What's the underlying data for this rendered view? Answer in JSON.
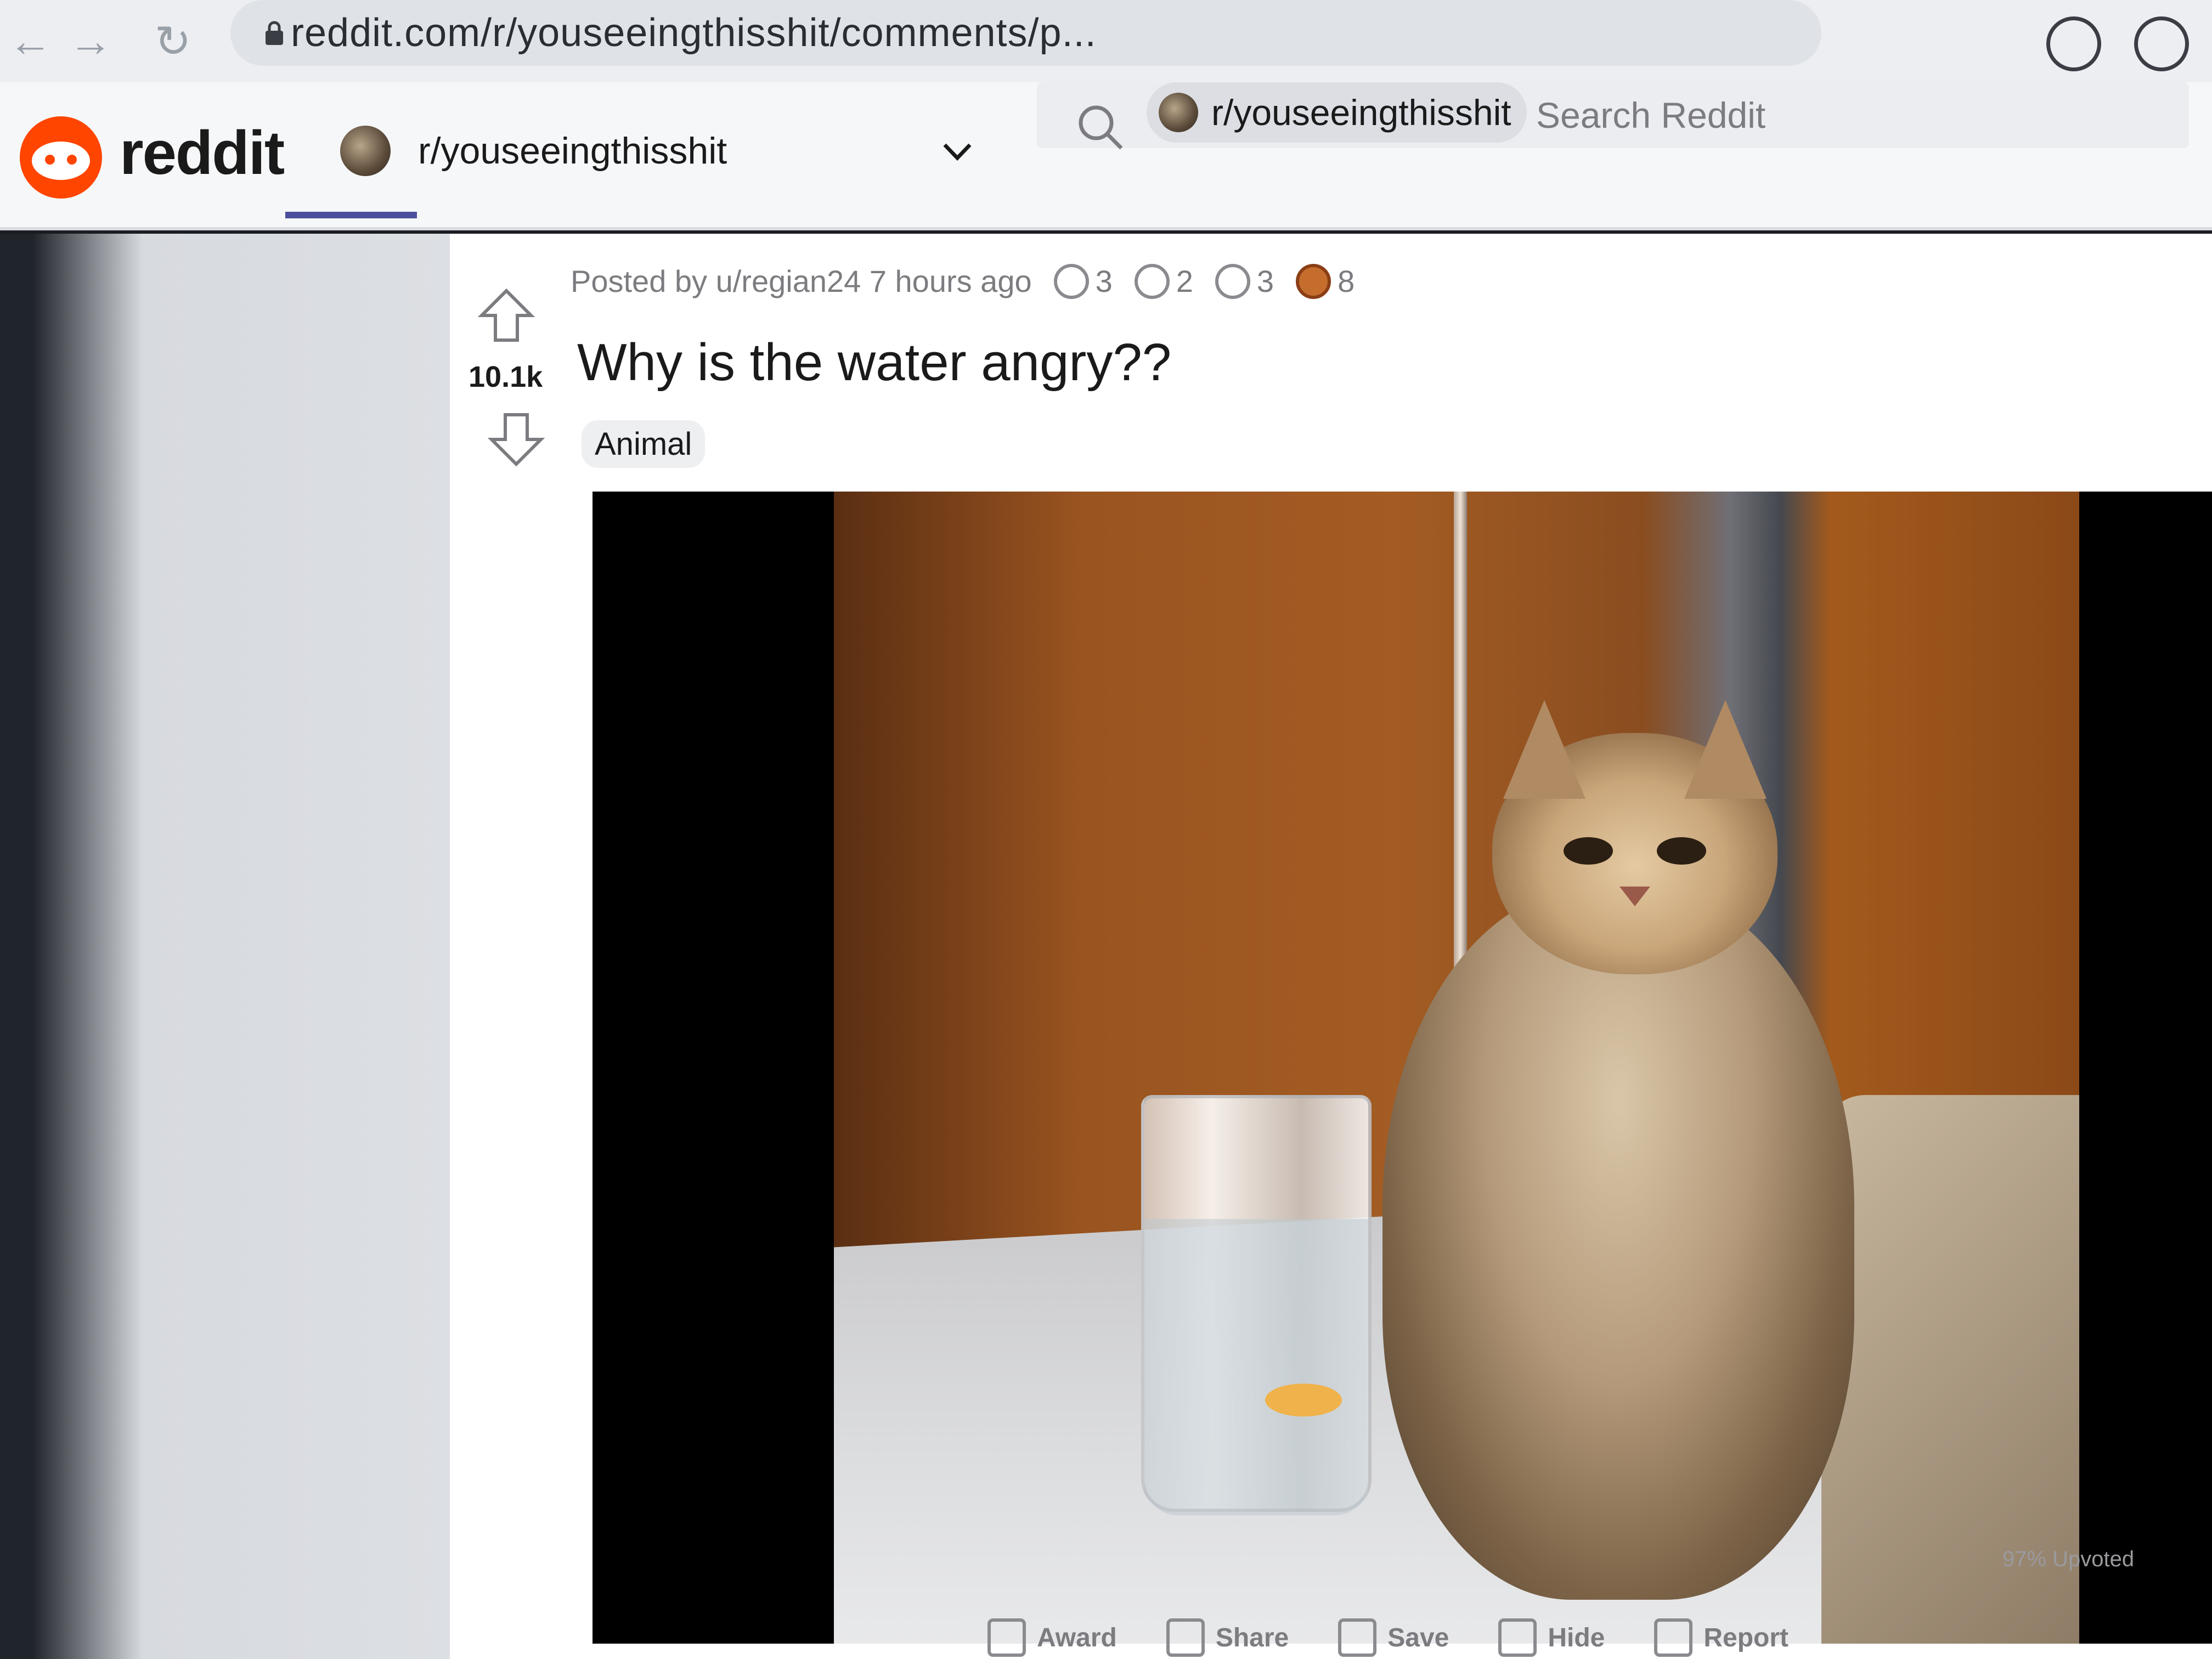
{
  "browser": {
    "url": "reddit.com/r/youseeingthisshit/comments/p...",
    "back_icon": "arrow-left-icon",
    "forward_icon": "arrow-right-icon",
    "reload_icon": "reload-icon"
  },
  "header": {
    "logo_text": "reddit",
    "community": "r/youseeingthisshit",
    "search_chip": "r/youseeingthisshit",
    "search_placeholder": "Search Reddit"
  },
  "post": {
    "votes": "10.1k",
    "meta": "Posted by u/regian24 7 hours ago",
    "awards": [
      {
        "icon": "silver-award-icon",
        "count": "3"
      },
      {
        "icon": "helpful-award-icon",
        "count": "2"
      },
      {
        "icon": "coin-award-icon",
        "count": "3"
      },
      {
        "icon": "bear-award-icon",
        "count": "8"
      }
    ],
    "title": "Why is the water angry??",
    "flair": "Animal",
    "upvoted_ratio": "97% Upvoted"
  },
  "actions": {
    "award": "Award",
    "share": "Share",
    "save": "Save",
    "hide": "Hide",
    "report": "Report"
  },
  "colors": {
    "brand": "#ff4500",
    "tab_underline": "#4b4f9c"
  }
}
